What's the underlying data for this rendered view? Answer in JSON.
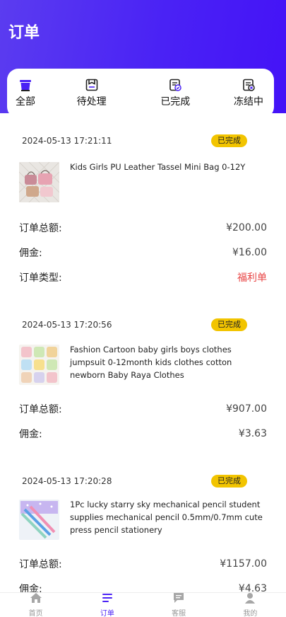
{
  "header": {
    "title": "订单"
  },
  "tabs": [
    {
      "label": "全部",
      "icon": "all-orders-icon",
      "active": true
    },
    {
      "label": "待处理",
      "icon": "pending-icon",
      "active": false
    },
    {
      "label": "已完成",
      "icon": "completed-icon",
      "active": false
    },
    {
      "label": "冻结中",
      "icon": "frozen-icon",
      "active": false
    }
  ],
  "orders": [
    {
      "date": "2024-05-13 17:21:11",
      "status": "已完成",
      "product_title": "Kids Girls PU Leather Tassel Mini Bag 0-12Y",
      "total_label": "订单总额:",
      "total_value": "¥200.00",
      "commission_label": "佣金:",
      "commission_value": "¥16.00",
      "type_label": "订单类型:",
      "type_value": "福利单"
    },
    {
      "date": "2024-05-13 17:20:56",
      "status": "已完成",
      "product_title": "Fashion Cartoon baby girls boys clothes jumpsuit 0-12month kids clothes cotton newborn Baby Raya Clothes",
      "total_label": "订单总额:",
      "total_value": "¥907.00",
      "commission_label": "佣金:",
      "commission_value": "¥3.63"
    },
    {
      "date": "2024-05-13 17:20:28",
      "status": "已完成",
      "product_title": "1Pc lucky starry sky mechanical pencil student supplies mechanical pencil 0.5mm/0.7mm cute press pencil stationery",
      "total_label": "订单总额:",
      "total_value": "¥1157.00",
      "commission_label": "佣金:",
      "commission_value": "¥4.63"
    }
  ],
  "bottom_nav": [
    {
      "label": "首页",
      "icon": "home-icon",
      "active": false
    },
    {
      "label": "订单",
      "icon": "orders-list-icon",
      "active": true
    },
    {
      "label": "客服",
      "icon": "chat-icon",
      "active": false
    },
    {
      "label": "我的",
      "icon": "user-icon",
      "active": false
    }
  ],
  "colors": {
    "header": "#4a22f5",
    "accent": "#4a22f5",
    "badge": "#f2c400",
    "welfare_red": "#e84545"
  }
}
